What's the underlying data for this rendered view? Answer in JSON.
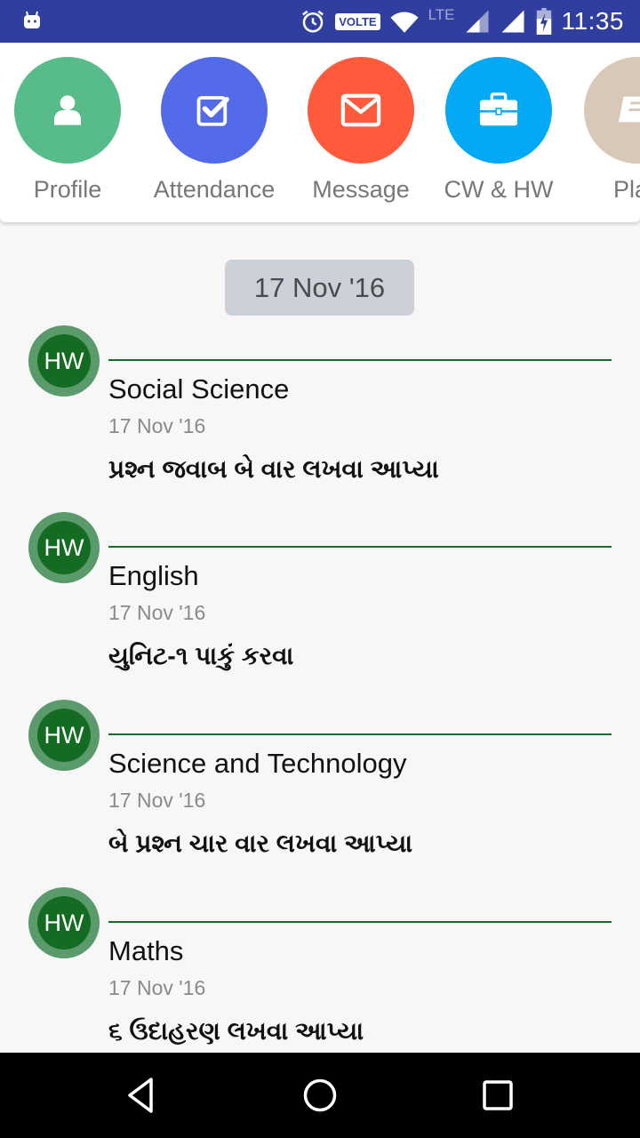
{
  "status_bar": {
    "time": "11:35",
    "volte_label": "VOLTE",
    "network_label": "LTE",
    "icons": [
      "android-debug-icon",
      "alarm-icon",
      "volte-icon",
      "wifi-icon",
      "signal-icon",
      "signal-icon",
      "battery-charging-icon"
    ]
  },
  "shortcuts": [
    {
      "label": "Profile",
      "icon": "person-icon",
      "color": "#57bb8a"
    },
    {
      "label": "Attendance",
      "icon": "checkbox-icon",
      "color": "#536be8"
    },
    {
      "label": "Message",
      "icon": "envelope-icon",
      "color": "#ff5a3c"
    },
    {
      "label": "CW & HW",
      "icon": "briefcase-icon",
      "color": "#03a9f4"
    },
    {
      "label": "Plan",
      "icon": "book-icon",
      "color": "#d7c8b8"
    }
  ],
  "date_header": "17 Nov '16",
  "entries": [
    {
      "badge": "HW",
      "subject": "Social Science",
      "date": "17 Nov '16",
      "description": "પ્રશ્ન જવાબ બે વાર લખવા આપ્યા"
    },
    {
      "badge": "HW",
      "subject": "English",
      "date": "17 Nov '16",
      "description": "યુનિટ-૧ પાકું કરવા"
    },
    {
      "badge": "HW",
      "subject": "Science and Technology",
      "date": "17 Nov '16",
      "description": "બે પ્રશ્ન ચાર વાર લખવા આપ્યા"
    },
    {
      "badge": "HW",
      "subject": "Maths",
      "date": "17 Nov '16",
      "description": "૬ ઉદાહરણ લખવા આપ્યા"
    }
  ],
  "colors": {
    "status_bar": "#303f9f",
    "hw_badge_outer": "#5b9a6a",
    "hw_badge_inner": "#146c23",
    "divider": "#1b6b2a"
  },
  "nav_bar": {
    "buttons": [
      "back-icon",
      "home-icon",
      "recents-icon"
    ]
  }
}
